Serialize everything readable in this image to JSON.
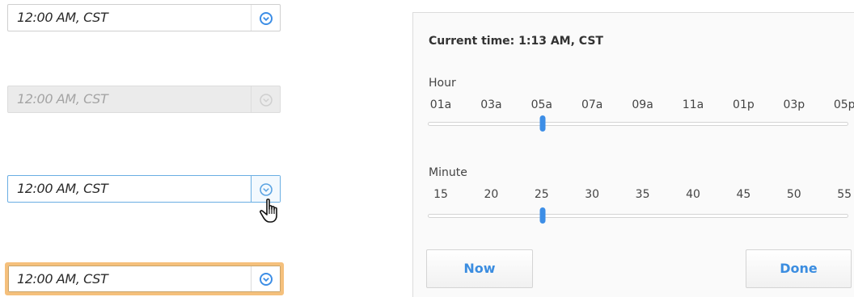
{
  "fields": [
    {
      "value": "12:00 AM, CST",
      "state": "default"
    },
    {
      "value": "12:00 AM, CST",
      "state": "disabled"
    },
    {
      "value": "12:00 AM, CST",
      "state": "hover"
    },
    {
      "value": "12:00 AM, CST",
      "state": "focused"
    }
  ],
  "icons": {
    "dropdown": "chevron-circle-down-icon",
    "cursor": "hand-pointer-icon"
  },
  "colors": {
    "accent": "#3d8ee6",
    "hover_border": "#6aaee3",
    "focus_ring": "#f5c07c",
    "disabled_bg": "#ebebeb"
  },
  "picker": {
    "current_time": "Current time: 1:13 AM, CST",
    "hour": {
      "label": "Hour",
      "ticks": [
        "01a",
        "03a",
        "05a",
        "07a",
        "09a",
        "11a",
        "01p",
        "03p",
        "05p"
      ],
      "selected_index": 2
    },
    "minute": {
      "label": "Minute",
      "ticks": [
        "15",
        "20",
        "25",
        "30",
        "35",
        "40",
        "45",
        "50",
        "55"
      ],
      "selected_index": 2
    },
    "now_label": "Now",
    "done_label": "Done"
  }
}
